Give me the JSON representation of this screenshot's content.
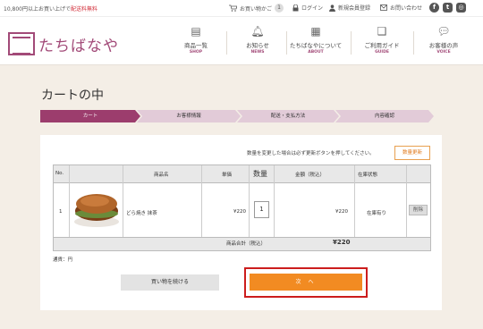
{
  "topbar": {
    "promo_prefix": "10,800円以上お買い上げで",
    "promo_highlight": "配送料無料",
    "cart_label": "お買い物かご",
    "cart_count": "1",
    "login_label": "ログイン",
    "register_label": "新規会員登録",
    "contact_label": "お問い合わせ"
  },
  "logo": {
    "text": "たちばなや"
  },
  "gnav": [
    {
      "label": "商品一覧",
      "sub": "SHOP"
    },
    {
      "label": "お知らせ",
      "sub": "NEWS"
    },
    {
      "label": "たちばなやについて",
      "sub": "ABOUT"
    },
    {
      "label": "ご利用ガイド",
      "sub": "GUIDE"
    },
    {
      "label": "お客様の声",
      "sub": "VOICE"
    }
  ],
  "page_title": "カートの中",
  "steps": [
    "カート",
    "お客様情報",
    "配送・支払方法",
    "内容確認"
  ],
  "notice": "数量を変更した場合は必ず更新ボタンを押してください。",
  "update_button": "数量更新",
  "table": {
    "headers": {
      "no": "No.",
      "name": "商品名",
      "unit": "単価",
      "qty": "数量",
      "amount": "金額（税込）",
      "stock": "在庫状態"
    },
    "row": {
      "no": "1",
      "name": "どら焼き 抹茶",
      "unit": "¥220",
      "qty": "1",
      "amount": "¥220",
      "stock": "在庫有り",
      "delete": "削除"
    },
    "summary_label": "商品合計（税込）",
    "summary_value": "¥220"
  },
  "currency_note": "通貨：円",
  "continue_button": "買い物を続ける",
  "next_button": "次 へ"
}
